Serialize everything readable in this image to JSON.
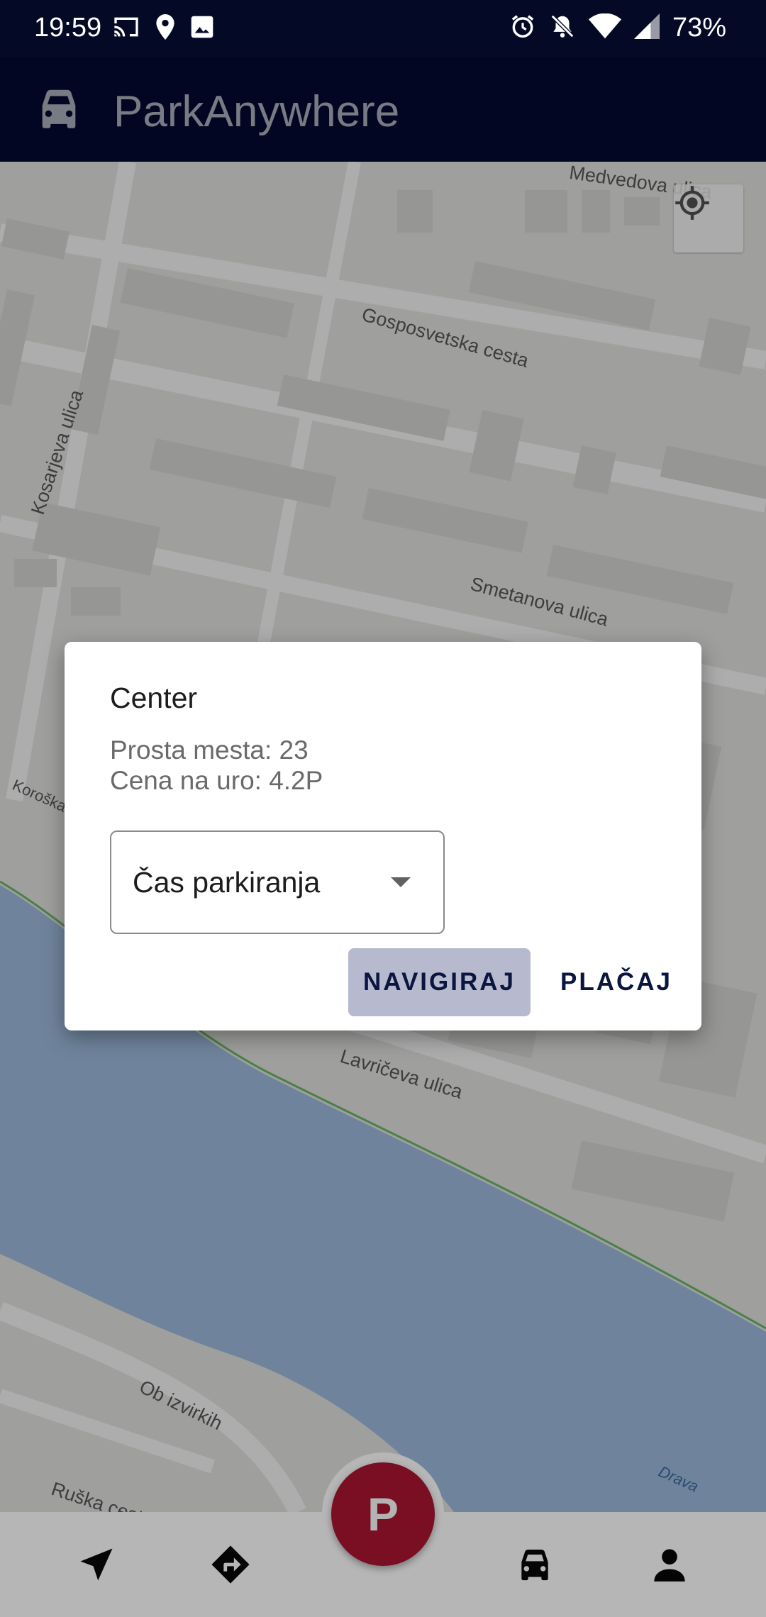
{
  "status_bar": {
    "time": "19:59",
    "battery": "73%",
    "left_icons": [
      "cast-icon",
      "location-pin-icon",
      "image-icon"
    ],
    "right_icons": [
      "alarm-icon",
      "notifications-off-icon",
      "wifi-icon",
      "signal-icon"
    ]
  },
  "app_bar": {
    "title": "ParkAnywhere",
    "logo_icon": "car-icon"
  },
  "map": {
    "streets": [
      "Medvedova ulica",
      "Gosposvetska cesta",
      "Kosarjeva ulica",
      "Smetanova ulica",
      "Koroška",
      "Lavričeva ulica",
      "Ob izvirkih",
      "Ruška cesta",
      "Drava"
    ],
    "locate_icon": "my-location-icon"
  },
  "dialog": {
    "title": "Center",
    "free_spots": "Prosta mesta: 23",
    "price": "Cena na uro: 4.2P",
    "select_value": "Čas parkiranja",
    "navigate_label": "NAVIGIRAJ",
    "pay_label": "PLAČAJ"
  },
  "bottom_nav": {
    "fab_label": "P",
    "items": [
      "navigation-icon",
      "directions-icon",
      "car-icon",
      "person-icon"
    ]
  },
  "colors": {
    "status_bar": "#040a26",
    "app_bar": "#040a33",
    "accent": "#0a1540",
    "fab": "#7a0e22",
    "water": "#a4c3e6"
  }
}
